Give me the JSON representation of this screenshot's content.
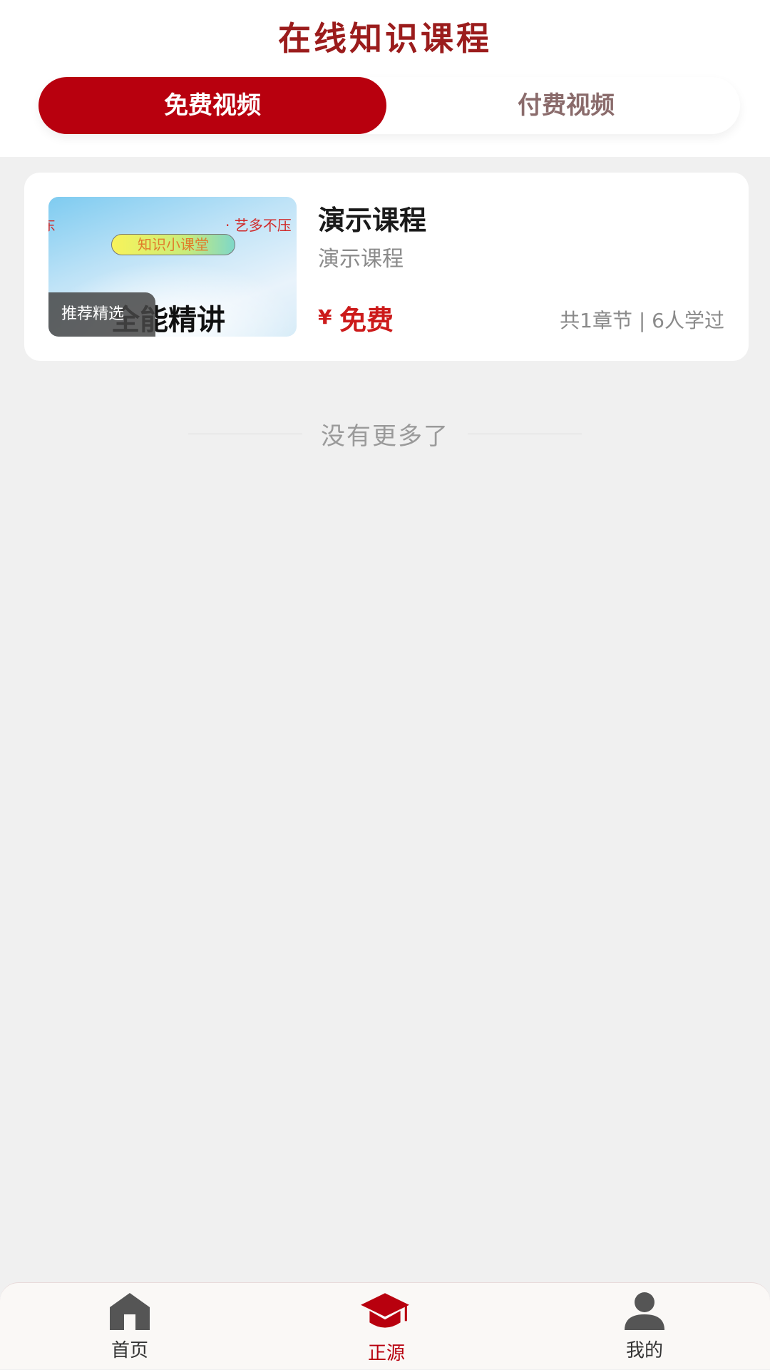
{
  "header": {
    "title": "在线知识课程",
    "tabs": [
      {
        "label": "免费视频",
        "active": true
      },
      {
        "label": "付费视频",
        "active": false
      }
    ]
  },
  "courses": [
    {
      "thumbnail": {
        "slogan": "· 艺多不压",
        "edge_text": "东",
        "pill": "知识小课堂",
        "headline": "全能精讲",
        "badge": "推荐精选"
      },
      "title": "演示课程",
      "subtitle": "演示课程",
      "price_symbol": "¥",
      "price": "免费",
      "stats": "共1章节 | 6人学过"
    }
  ],
  "list_end_text": "没有更多了",
  "tabbar": {
    "items": [
      {
        "label": "首页",
        "icon": "home-icon",
        "active": false
      },
      {
        "label": "正源",
        "icon": "graduation-cap-icon",
        "active": true
      },
      {
        "label": "我的",
        "icon": "user-icon",
        "active": false
      }
    ]
  },
  "colors": {
    "accent": "#b8000e",
    "title": "#9b1c1c",
    "price": "#cc1a1a",
    "background": "#f0f0f0"
  }
}
